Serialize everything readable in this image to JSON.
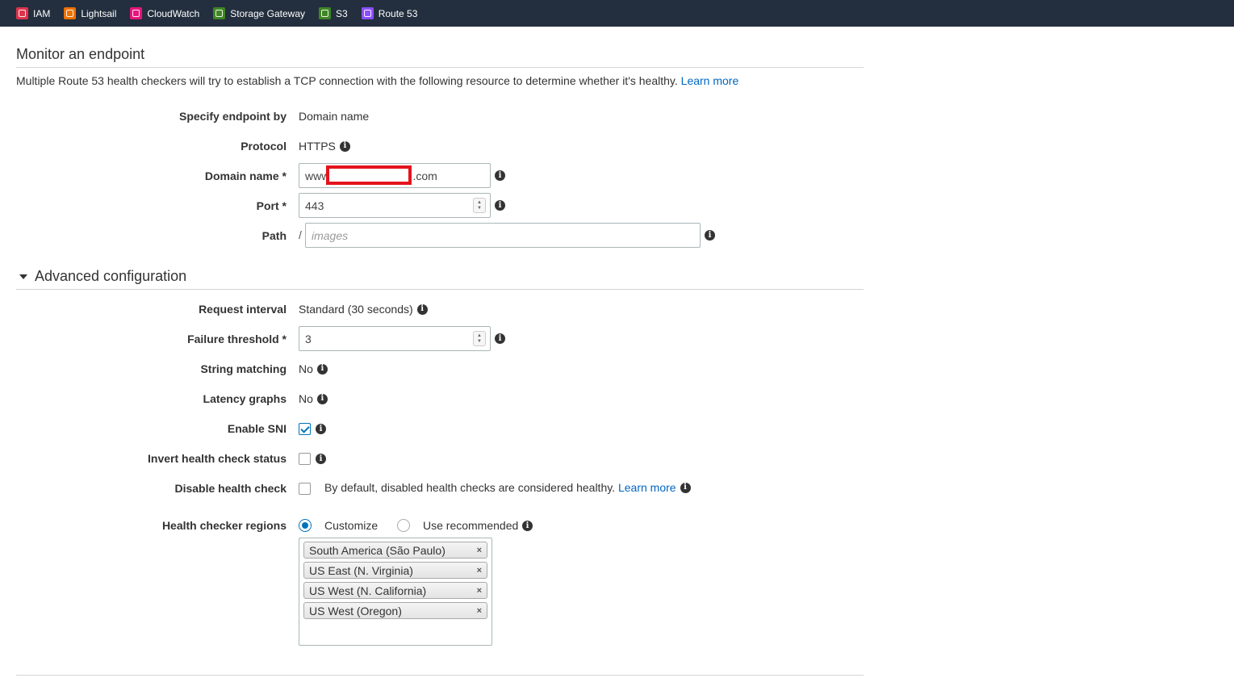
{
  "nav": {
    "services": [
      {
        "label": "IAM",
        "color": "#dd344c",
        "icon": "iam-icon"
      },
      {
        "label": "Lightsail",
        "color": "#ed7100",
        "icon": "lightsail-icon"
      },
      {
        "label": "CloudWatch",
        "color": "#e7157b",
        "icon": "cloudwatch-icon"
      },
      {
        "label": "Storage Gateway",
        "color": "#3f8624",
        "icon": "storage-gateway-icon"
      },
      {
        "label": "S3",
        "color": "#3f8624",
        "icon": "s3-icon"
      },
      {
        "label": "Route 53",
        "color": "#8c4fff",
        "icon": "route53-icon"
      }
    ]
  },
  "monitor": {
    "title": "Monitor an endpoint",
    "description": "Multiple Route 53 health checkers will try to establish a TCP connection with the following resource to determine whether it's healthy.",
    "learn_more": "Learn more",
    "specify_label": "Specify endpoint by",
    "specify_value": "Domain name",
    "protocol_label": "Protocol",
    "protocol_value": "HTTPS",
    "domain_label": "Domain name *",
    "domain_prefix": "www.",
    "domain_suffix": ".com",
    "port_label": "Port *",
    "port_value": "443",
    "path_label": "Path",
    "path_slash": "/",
    "path_placeholder": "images"
  },
  "advanced": {
    "title": "Advanced configuration",
    "request_interval_label": "Request interval",
    "request_interval_value": "Standard (30 seconds)",
    "failure_threshold_label": "Failure threshold *",
    "failure_threshold_value": "3",
    "string_matching_label": "String matching",
    "string_matching_value": "No",
    "latency_graphs_label": "Latency graphs",
    "latency_graphs_value": "No",
    "enable_sni_label": "Enable SNI",
    "enable_sni_checked": true,
    "invert_label": "Invert health check status",
    "invert_checked": false,
    "disable_label": "Disable health check",
    "disable_checked": false,
    "disable_note": "By default, disabled health checks are considered healthy.",
    "disable_learn_more": "Learn more",
    "regions_label": "Health checker regions",
    "regions_option_customize": "Customize",
    "regions_option_recommended": "Use recommended",
    "regions_selected_option": "Customize",
    "regions": [
      "South America (São Paulo)",
      "US East (N. Virginia)",
      "US West (N. California)",
      "US West (Oregon)"
    ],
    "remove_glyph": "×"
  }
}
